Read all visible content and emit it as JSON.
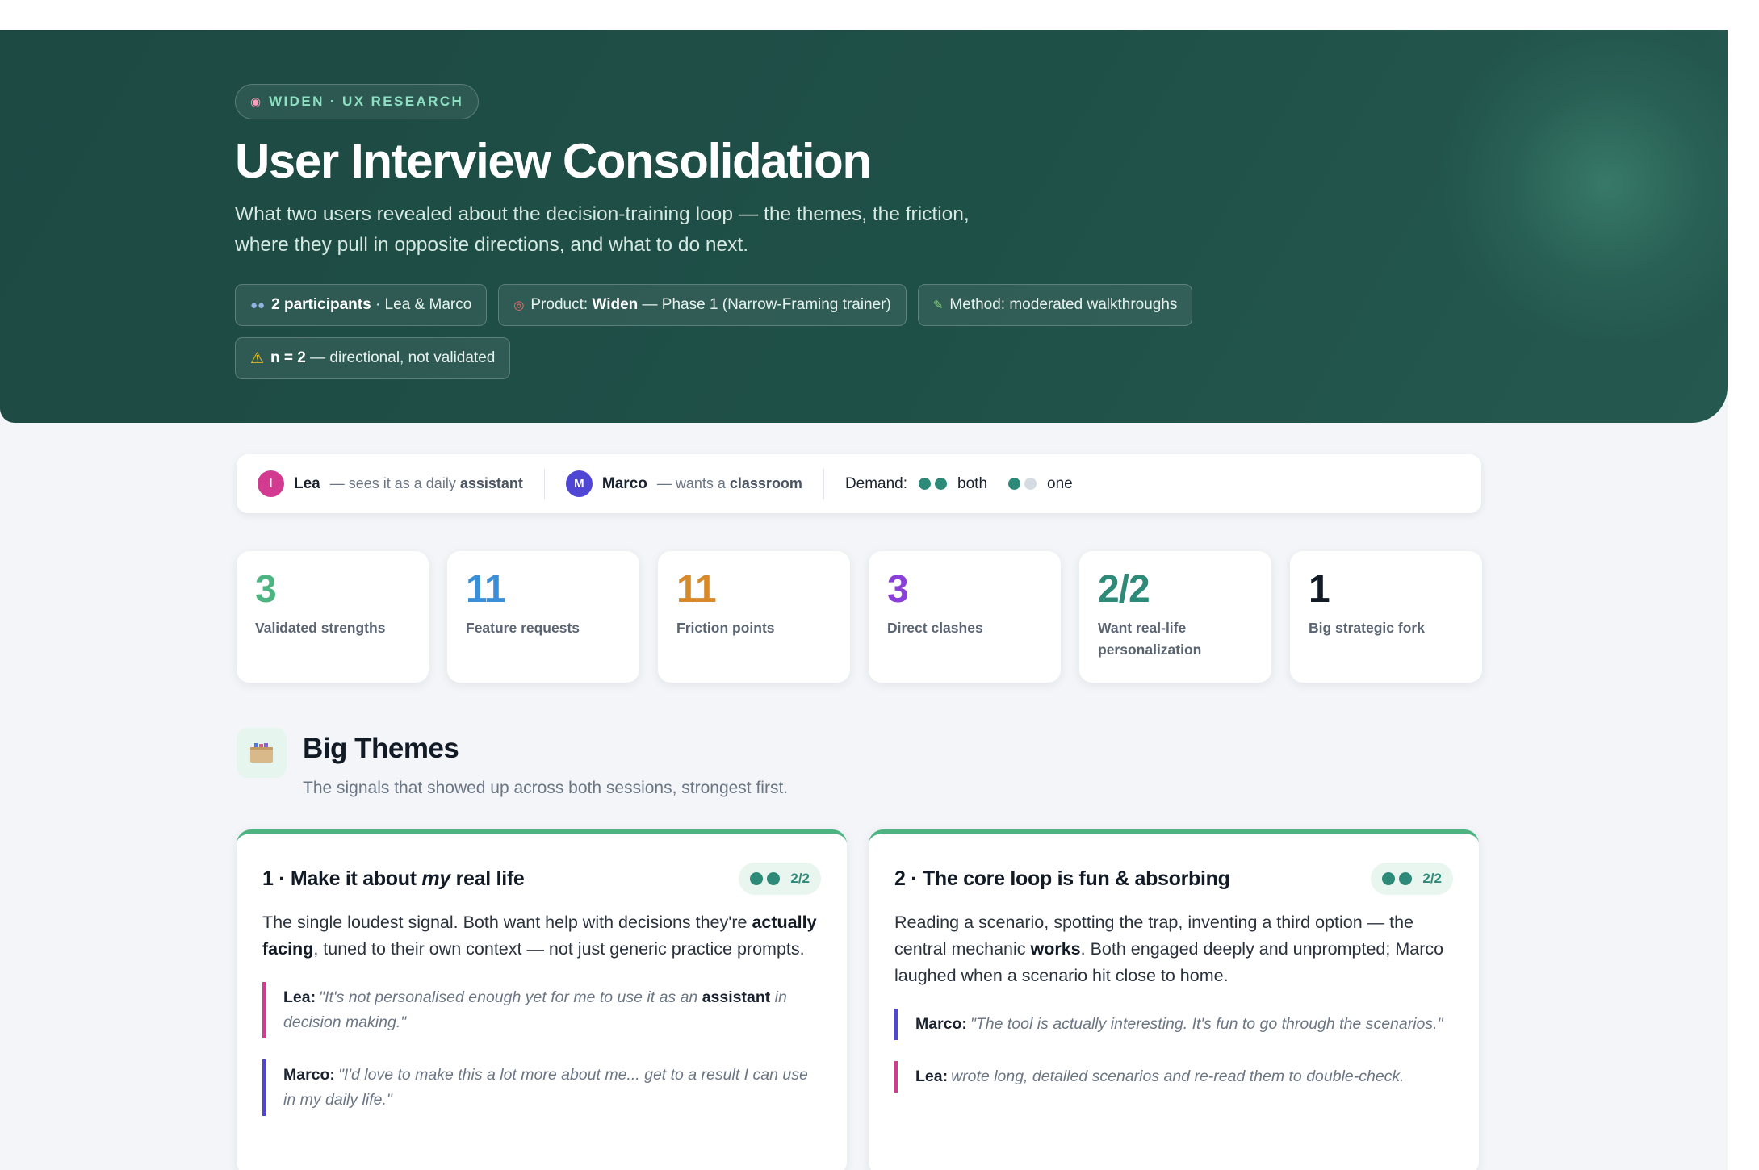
{
  "hero": {
    "eyebrow_icon": "brain-icon",
    "eyebrow": "WIDEN · UX RESEARCH",
    "title": "User Interview Consolidation",
    "subtitle_line1": "What two users revealed about the decision-training loop — the themes, the friction,",
    "subtitle_line2": "where they pull in opposite directions, and what to do next.",
    "chips": {
      "participants_bold": "2 participants",
      "participants_rest": " · Lea & Marco",
      "product_prefix": "Product: ",
      "product_bold": "Widen",
      "product_rest": " — Phase 1 (Narrow-Framing trainer)",
      "method": "Method: moderated walkthroughs",
      "n_bold": "n = 2",
      "n_rest": " — directional, not validated"
    }
  },
  "legend": {
    "lea_initial": "l",
    "lea_name": "Lea",
    "lea_desc_prefix": "— sees it as a daily ",
    "lea_desc_bold": "assistant",
    "marco_initial": "M",
    "marco_name": "Marco",
    "marco_desc_prefix": "— wants a ",
    "marco_desc_bold": "classroom",
    "demand_label": "Demand:",
    "both_label": "both",
    "one_label": "one"
  },
  "stats": [
    {
      "value": "3",
      "label": "Validated strengths",
      "color": "#4cb381"
    },
    {
      "value": "11",
      "label": "Feature requests",
      "color": "#3a8fd8"
    },
    {
      "value": "11",
      "label": "Friction points",
      "color": "#d88a2a"
    },
    {
      "value": "3",
      "label": "Direct clashes",
      "color": "#8a3fd8"
    },
    {
      "value": "2/2",
      "label": "Want real-life personalization",
      "color": "#2e8a78"
    },
    {
      "value": "1",
      "label": "Big strategic fork",
      "color": "#121a26"
    }
  ],
  "section": {
    "icon": "package-icon",
    "title": "Big Themes",
    "subtitle": "The signals that showed up across both sessions, strongest first."
  },
  "themes": [
    {
      "title_pre": "1 · Make it about ",
      "title_em": "my",
      "title_post": " real life",
      "demand": "2/2",
      "body_1": "The single loudest signal. Both want help with decisions they're ",
      "body_bold": "actually facing",
      "body_2": ", tuned to their own context — not just generic practice prompts.",
      "q1_who": "Lea:",
      "q1_text": "\"It's not personalised enough yet for me to use it as an ",
      "q1_bold": "assistant",
      "q1_end": " in decision making.\"",
      "q2_who": "Marco:",
      "q2_text": "\"I'd love to make this a lot more about me... get to a result I can use in my daily life.\""
    },
    {
      "title_pre": "2 · The core loop is fun & absorbing",
      "demand": "2/2",
      "body_1": "Reading a scenario, spotting the trap, inventing a third option — the central mechanic ",
      "body_bold": "works",
      "body_2": ". Both engaged deeply and unprompted; Marco laughed when a scenario hit close to home.",
      "q1_who": "Marco:",
      "q1_text": "\"The tool is actually interesting. It's fun to go through the scenarios.\"",
      "q2_who": "Lea:",
      "q2_text": "wrote long, detailed scenarios and re-read them to double-check."
    }
  ]
}
